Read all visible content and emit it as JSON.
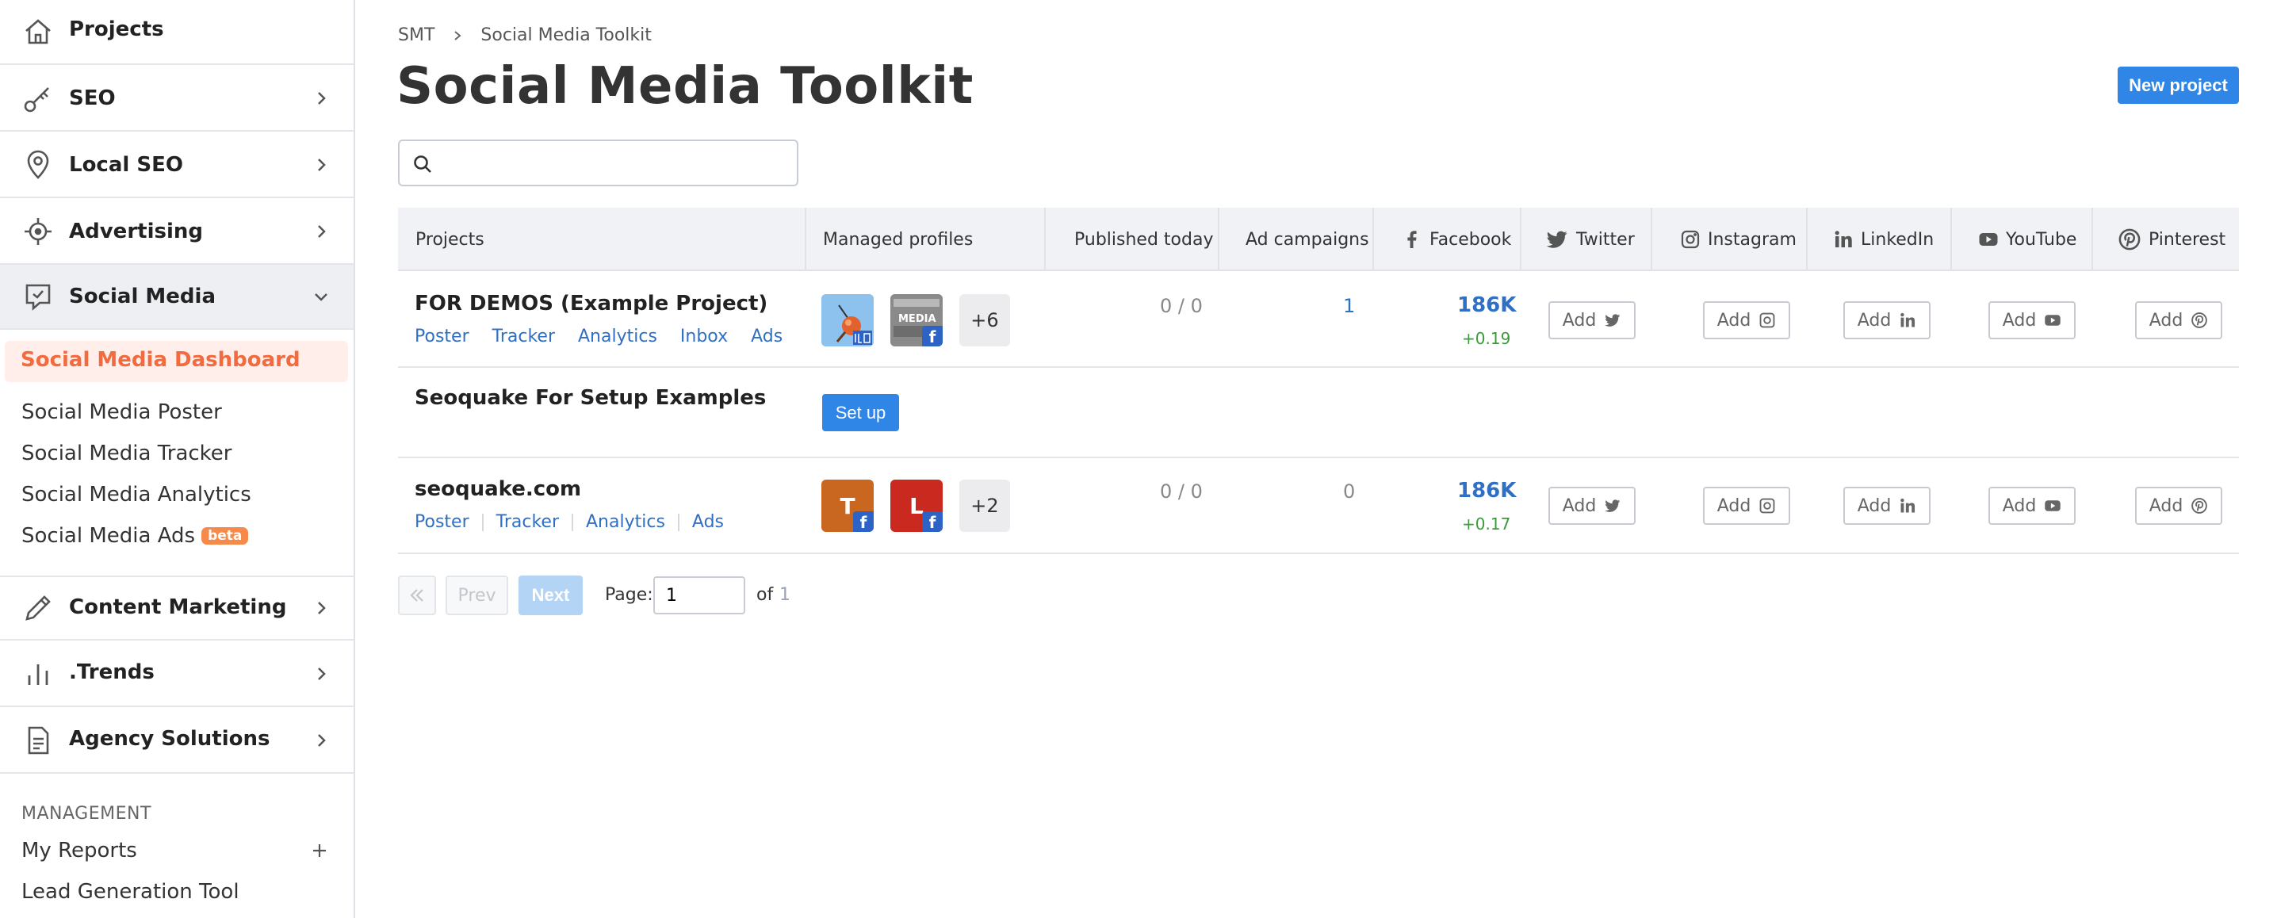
{
  "sidebar": {
    "projects": "Projects",
    "seo": "SEO",
    "local_seo": "Local SEO",
    "advertising": "Advertising",
    "social_media": "Social Media",
    "sub_items": {
      "dashboard": "Social Media Dashboard",
      "poster": "Social Media Poster",
      "tracker": "Social Media Tracker",
      "analytics": "Social Media Analytics",
      "ads": "Social Media Ads",
      "ads_badge": "beta"
    },
    "content_marketing": "Content Marketing",
    "trends": ".Trends",
    "agency": "Agency Solutions",
    "management_label": "MANAGEMENT",
    "my_reports": "My Reports",
    "lead_gen": "Lead Generation Tool"
  },
  "header": {
    "breadcrumb": [
      "SMT",
      "Social Media Toolkit"
    ],
    "title": "Social Media Toolkit",
    "new_project": "New project"
  },
  "search": {
    "placeholder": ""
  },
  "table": {
    "columns": {
      "projects": "Projects",
      "managed": "Managed profiles",
      "published": "Published today",
      "ads": "Ad campaigns",
      "facebook": "Facebook",
      "twitter": "Twitter",
      "instagram": "Instagram",
      "linkedin": "LinkedIn",
      "youtube": "YouTube",
      "pinterest": "Pinterest"
    },
    "add_label": "Add",
    "rows": [
      {
        "name": "FOR DEMOS (Example Project)",
        "links": [
          "Poster",
          "Tracker",
          "Analytics",
          "Inbox",
          "Ads"
        ],
        "more": "+6",
        "avatar2_text": "MEDIA",
        "published": "0 / 0",
        "ad_campaigns": "1",
        "facebook": "186K",
        "facebook_delta": "+0.19"
      },
      {
        "name": "Seoquake For Setup Examples",
        "setup": "Set up"
      },
      {
        "name": "seoquake.com",
        "links": [
          "Poster",
          "Tracker",
          "Analytics",
          "Ads"
        ],
        "avatars": [
          "T",
          "L"
        ],
        "more": "+2",
        "published": "0 / 0",
        "ad_campaigns": "0",
        "facebook": "186K",
        "facebook_delta": "+0.17"
      }
    ]
  },
  "pagination": {
    "prev": "Prev",
    "next": "Next",
    "page_label": "Page:",
    "page_value": "1",
    "of_label": "of",
    "total": "1"
  },
  "colors": {
    "accent_blue": "#2f86e6",
    "active_orange": "#f26a3e",
    "link_blue": "#2f6fc4",
    "positive_green": "#3a9a3a"
  }
}
